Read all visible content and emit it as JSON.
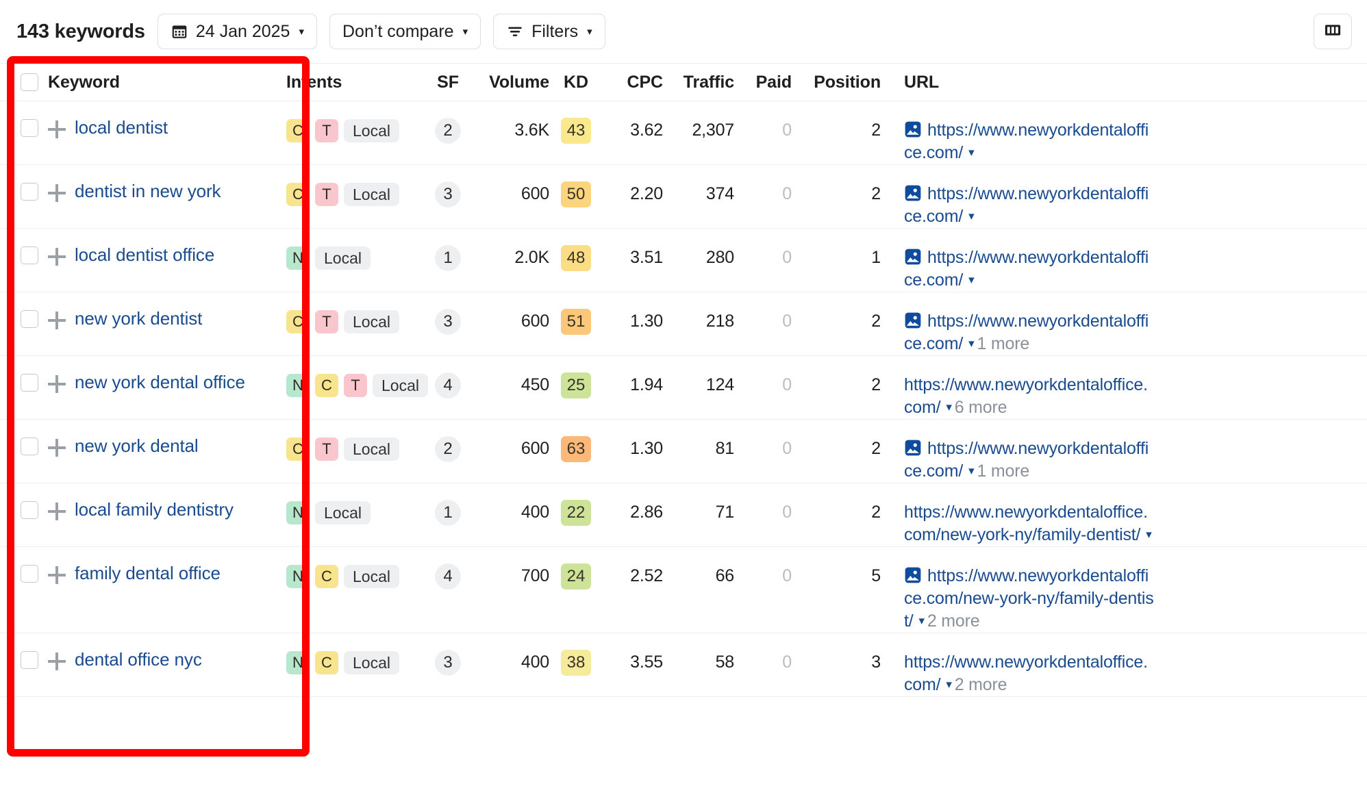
{
  "toolbar": {
    "keyword_count_label": "143 keywords",
    "date_button": {
      "label": "24 Jan 2025",
      "icon": "calendar-icon",
      "caret": "▾"
    },
    "compare_button": {
      "label": "Don’t compare",
      "caret": "▾"
    },
    "filters_button": {
      "label": "Filters",
      "icon": "filter-icon",
      "caret": "▾"
    },
    "columns_button": {
      "icon": "columns-icon"
    }
  },
  "table": {
    "columns": [
      "Keyword",
      "Intents",
      "SF",
      "Volume",
      "KD",
      "CPC",
      "Traffic",
      "Paid",
      "Position",
      "URL"
    ],
    "rows": [
      {
        "keyword": "local dentist",
        "intents": [
          "C",
          "T"
        ],
        "local": "Local",
        "sf": "2",
        "volume": "3.6K",
        "kd": "43",
        "kd_color": "#fae88c",
        "cpc": "3.62",
        "traffic": "2,307",
        "paid": "0",
        "position": "2",
        "url": "https://www.newyorkdentaloffice.com/",
        "has_serp_icon": true,
        "more": ""
      },
      {
        "keyword": "dentist in new york",
        "intents": [
          "C",
          "T"
        ],
        "local": "Local",
        "sf": "3",
        "volume": "600",
        "kd": "50",
        "kd_color": "#fbd47e",
        "cpc": "2.20",
        "traffic": "374",
        "paid": "0",
        "position": "2",
        "url": "https://www.newyorkdentaloffice.com/",
        "has_serp_icon": true,
        "more": ""
      },
      {
        "keyword": "local dentist office",
        "intents": [
          "N"
        ],
        "local": "Local",
        "sf": "1",
        "volume": "2.0K",
        "kd": "48",
        "kd_color": "#fbdd86",
        "cpc": "3.51",
        "traffic": "280",
        "paid": "0",
        "position": "1",
        "url": "https://www.newyorkdentaloffice.com/",
        "has_serp_icon": true,
        "more": ""
      },
      {
        "keyword": "new york dentist",
        "intents": [
          "C",
          "T"
        ],
        "local": "Local",
        "sf": "3",
        "volume": "600",
        "kd": "51",
        "kd_color": "#fbc87a",
        "cpc": "1.30",
        "traffic": "218",
        "paid": "0",
        "position": "2",
        "url": "https://www.newyorkdentaloffice.com/",
        "has_serp_icon": true,
        "more": "1 more"
      },
      {
        "keyword": "new york dental office",
        "intents": [
          "N",
          "C",
          "T"
        ],
        "local": "Local",
        "sf": "4",
        "volume": "450",
        "kd": "25",
        "kd_color": "#cde39a",
        "cpc": "1.94",
        "traffic": "124",
        "paid": "0",
        "position": "2",
        "url": "https://www.newyorkdentaloffice.com/",
        "has_serp_icon": false,
        "more": "6 more"
      },
      {
        "keyword": "new york dental",
        "intents": [
          "C",
          "T"
        ],
        "local": "Local",
        "sf": "2",
        "volume": "600",
        "kd": "63",
        "kd_color": "#fbb878",
        "cpc": "1.30",
        "traffic": "81",
        "paid": "0",
        "position": "2",
        "url": "https://www.newyorkdentaloffice.com/",
        "has_serp_icon": true,
        "more": "1 more"
      },
      {
        "keyword": "local family dentistry",
        "intents": [
          "N"
        ],
        "local": "Local",
        "sf": "1",
        "volume": "400",
        "kd": "22",
        "kd_color": "#cde39a",
        "cpc": "2.86",
        "traffic": "71",
        "paid": "0",
        "position": "2",
        "url": "https://www.newyorkdentaloffice.com/new-york-ny/family-dentist/",
        "has_serp_icon": false,
        "more": ""
      },
      {
        "keyword": "family dental office",
        "intents": [
          "N",
          "C"
        ],
        "local": "Local",
        "sf": "4",
        "volume": "700",
        "kd": "24",
        "kd_color": "#cde39a",
        "cpc": "2.52",
        "traffic": "66",
        "paid": "0",
        "position": "5",
        "url": "https://www.newyorkdentaloffice.com/new-york-ny/family-dentist/",
        "has_serp_icon": true,
        "more": "2 more"
      },
      {
        "keyword": "dental office nyc",
        "intents": [
          "N",
          "C"
        ],
        "local": "Local",
        "sf": "3",
        "volume": "400",
        "kd": "38",
        "kd_color": "#f6ea9b",
        "cpc": "3.55",
        "traffic": "58",
        "paid": "0",
        "position": "3",
        "url": "https://www.newyorkdentaloffice.com/",
        "has_serp_icon": false,
        "more": "2 more"
      }
    ]
  },
  "annotation": {
    "highlight_color": "#ff0000",
    "target": "keyword-column"
  }
}
